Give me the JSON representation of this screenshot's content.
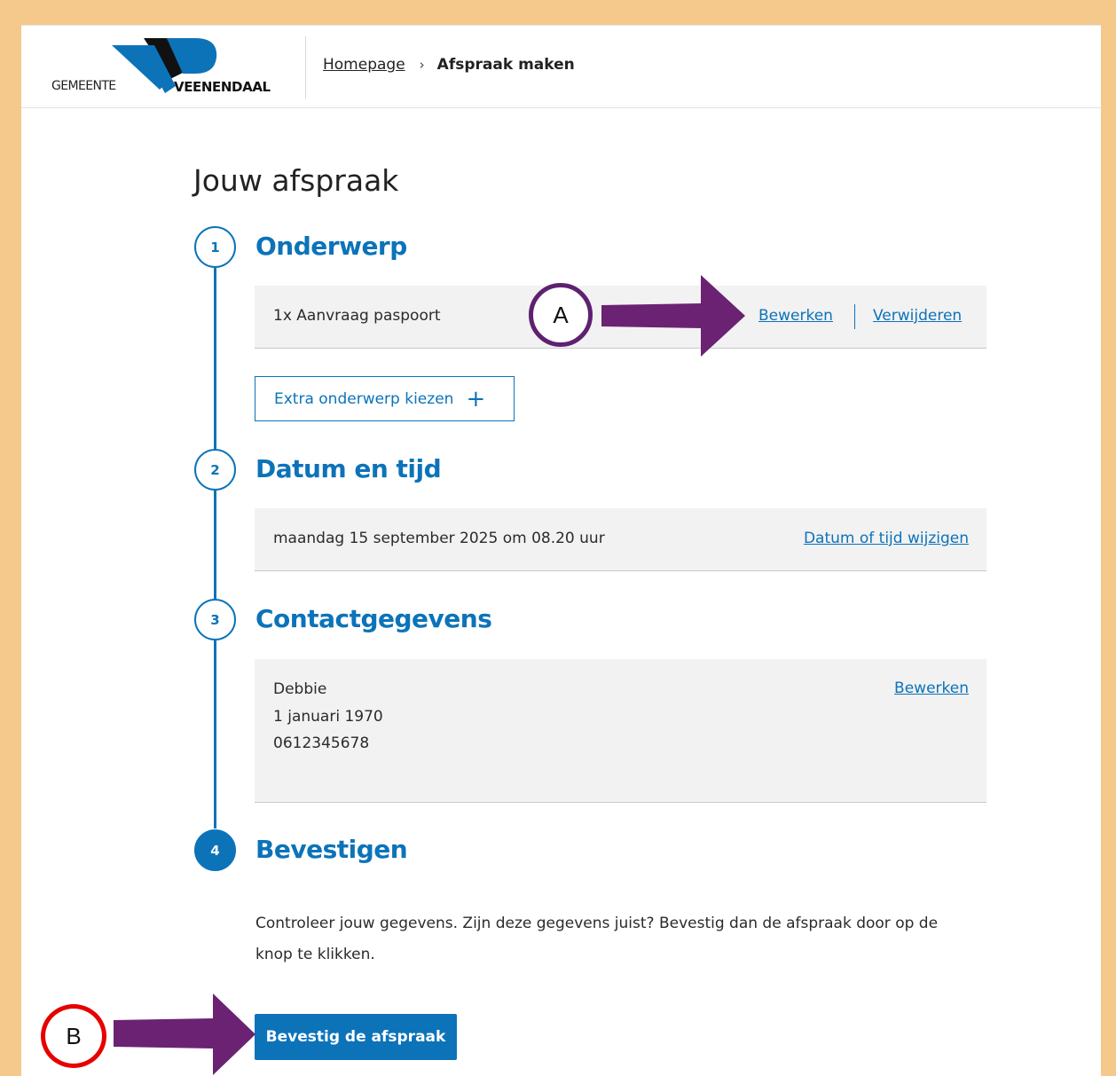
{
  "header": {
    "logo": {
      "word1": "GEMEENTE",
      "word2": "VEENENDAAL"
    },
    "breadcrumb": {
      "home": "Homepage",
      "separator": "›",
      "current": "Afspraak maken"
    }
  },
  "page_title": "Jouw afspraak",
  "steps": [
    {
      "number": "1",
      "title": "Onderwerp",
      "item": "1x Aanvraag paspoort",
      "edit_link": "Bewerken",
      "delete_link": "Verwijderen",
      "extra_button": "Extra onderwerp kiezen",
      "extra_icon": "+"
    },
    {
      "number": "2",
      "title": "Datum en tijd",
      "value": "maandag 15 september 2025 om 08.20 uur",
      "change_link": "Datum of tijd wijzigen"
    },
    {
      "number": "3",
      "title": "Contactgegevens",
      "name": "Debbie",
      "birthdate": "1 januari 1970",
      "phone": "0612345678",
      "edit_link": "Bewerken"
    },
    {
      "number": "4",
      "title": "Bevestigen",
      "instruction": "Controleer jouw gegevens. Zijn deze gegevens juist? Bevestig dan de afspraak door op de knop te klikken.",
      "confirm_button": "Bevestig de afspraak"
    }
  ],
  "annotations": {
    "marker_a": "A",
    "marker_b": "B",
    "arrow_color": "#6b2273",
    "marker_a_color": "#5e2170",
    "marker_b_color": "#e60000"
  },
  "colors": {
    "accent": "#0c73b9",
    "frame": "#f5c98c",
    "panel": "#f2f2f2"
  }
}
